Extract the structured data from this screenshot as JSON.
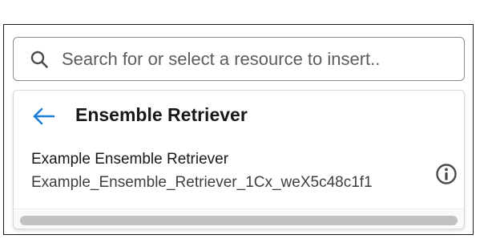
{
  "search": {
    "placeholder": "Search for or select a resource to insert..",
    "value": ""
  },
  "dropdown": {
    "title": "Ensemble Retriever",
    "items": [
      {
        "label": "Example Ensemble Retriever",
        "api_name": "Example_Ensemble_Retriever_1Cx_weX5c48c1f1",
        "info_icon": "info-icon"
      }
    ]
  },
  "icons": {
    "search": "search-icon",
    "back": "arrow-left-icon",
    "info": "info-icon"
  },
  "colors": {
    "accent": "#1b7fd9",
    "text_primary": "#181818",
    "text_secondary": "#3e3e3c",
    "border": "#8c8c8c"
  }
}
